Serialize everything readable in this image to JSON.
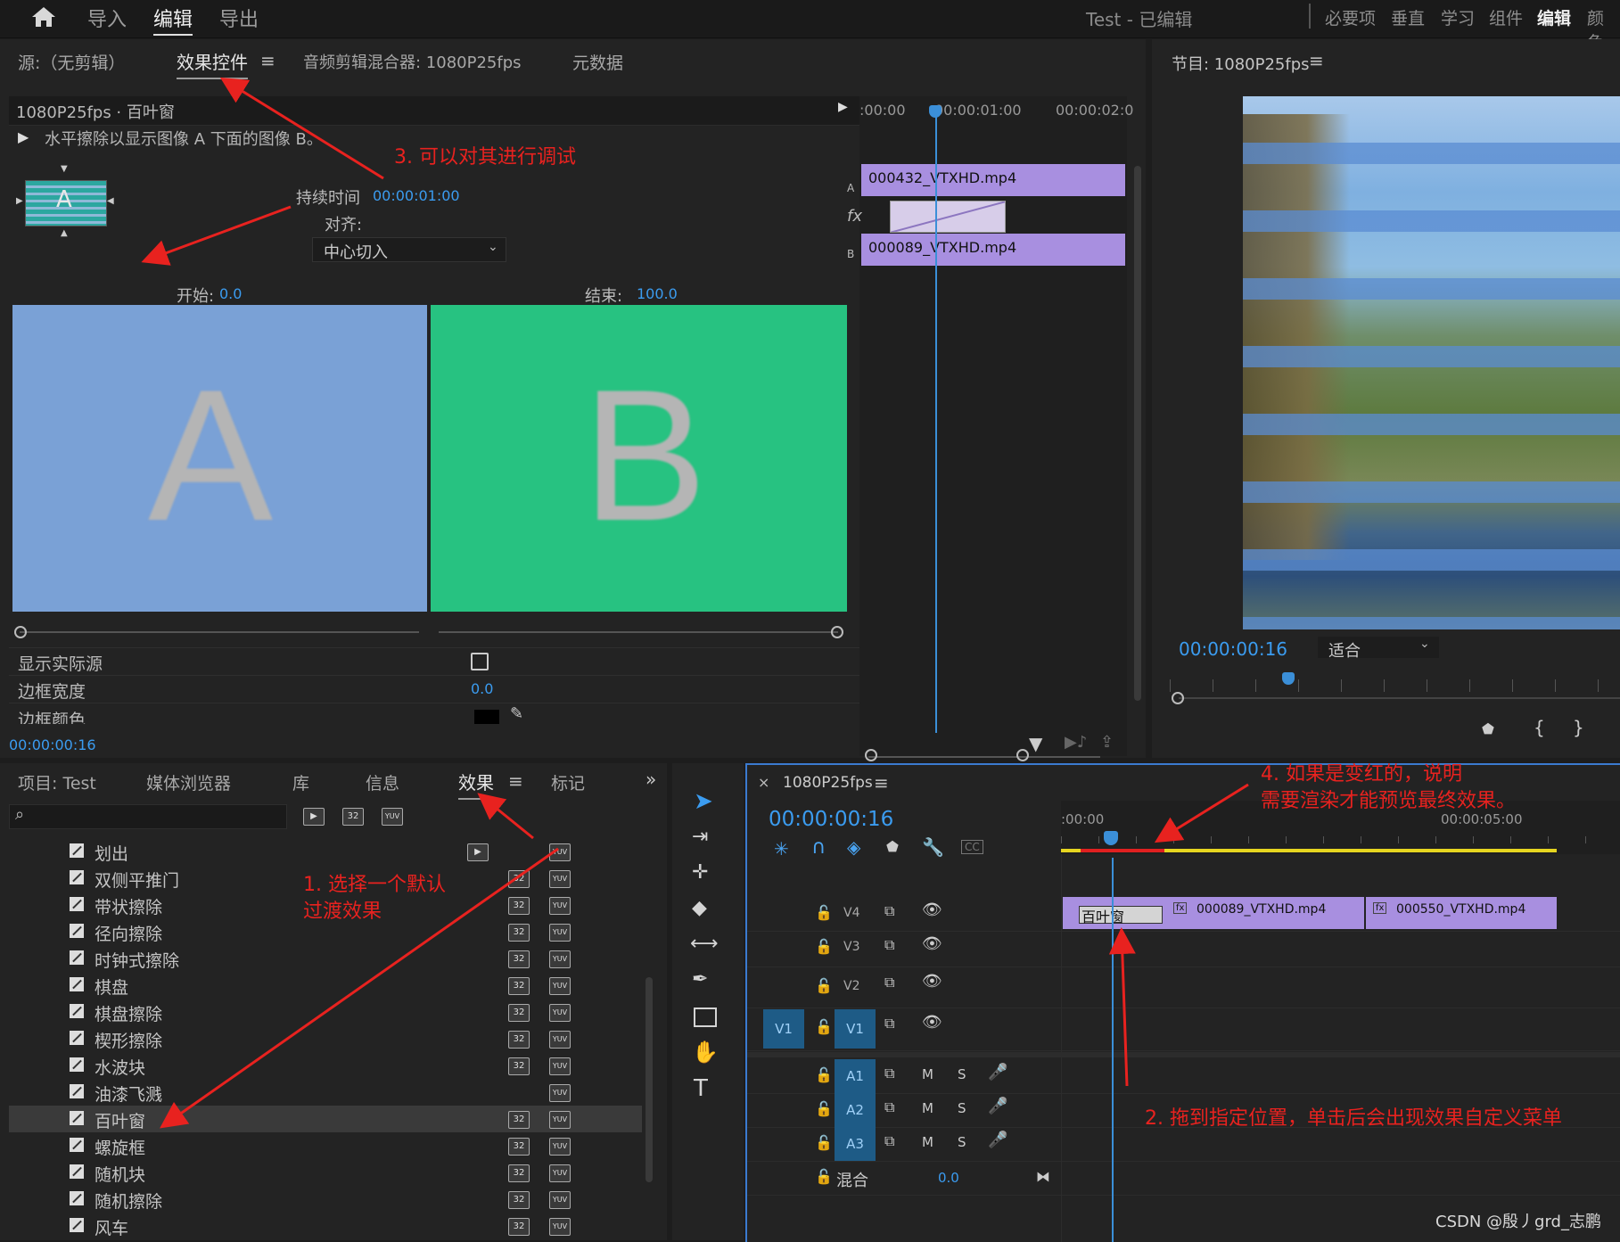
{
  "topbar": {
    "nav": [
      "导入",
      "编辑",
      "导出"
    ],
    "active": "编辑",
    "project_title": "Test - 已编辑",
    "workspaces": [
      "必要项",
      "垂直",
      "学习",
      "组件",
      "编辑",
      "颜色"
    ],
    "active_workspace": "编辑"
  },
  "source_panel": {
    "tabs": [
      "源:（无剪辑）",
      "效果控件",
      "音频剪辑混合器: 1080P25fps",
      "元数据"
    ],
    "active_tab": "效果控件",
    "clip_path": "1080P25fps · 百叶窗",
    "description": "水平擦除以显示图像 A 下面的图像 B。",
    "duration_label": "持续时间",
    "duration_value": "00:00:01:00",
    "align_label": "对齐:",
    "align_value": "中心切入",
    "start_label": "开始:",
    "start_value": "0.0",
    "end_label": "结束:",
    "end_value": "100.0",
    "preview_a": "A",
    "preview_b": "B",
    "show_actual_sources": "显示实际源",
    "border_width_label": "边框宽度",
    "border_width_value": "0.0",
    "border_color_label": "边框颜色",
    "timecode": "00:00:00:16",
    "mini_timeline": {
      "ruler": [
        ":00:00",
        "00:00:01:00",
        "00:00:02:0"
      ],
      "track_a_label": "A",
      "track_b_label": "B",
      "fx_label": "fx",
      "clip_a": "000432_VTXHD.mp4",
      "clip_b": "000089_VTXHD.mp4"
    }
  },
  "program_panel": {
    "title": "节目: 1080P25fps",
    "timecode": "00:00:00:16",
    "fit": "适合"
  },
  "project_panel": {
    "tabs": [
      "项目: Test",
      "媒体浏览器",
      "库",
      "信息",
      "效果",
      "标记"
    ],
    "active_tab": "效果",
    "search_placeholder": "",
    "effects": [
      {
        "name": "划出",
        "b32": false,
        "yuv": true,
        "acc": true
      },
      {
        "name": "双侧平推门",
        "b32": true,
        "yuv": true
      },
      {
        "name": "带状擦除",
        "b32": true,
        "yuv": true
      },
      {
        "name": "径向擦除",
        "b32": true,
        "yuv": true
      },
      {
        "name": "时钟式擦除",
        "b32": true,
        "yuv": true
      },
      {
        "name": "棋盘",
        "b32": true,
        "yuv": true
      },
      {
        "name": "棋盘擦除",
        "b32": true,
        "yuv": true
      },
      {
        "name": "楔形擦除",
        "b32": true,
        "yuv": true
      },
      {
        "name": "水波块",
        "b32": true,
        "yuv": true
      },
      {
        "name": "油漆飞溅",
        "b32": false,
        "yuv": true
      },
      {
        "name": "百叶窗",
        "b32": true,
        "yuv": true,
        "selected": true
      },
      {
        "name": "螺旋框",
        "b32": true,
        "yuv": true
      },
      {
        "name": "随机块",
        "b32": true,
        "yuv": true
      },
      {
        "name": "随机擦除",
        "b32": true,
        "yuv": true
      },
      {
        "name": "风车",
        "b32": true,
        "yuv": true
      }
    ],
    "badge_32": "32",
    "badge_yuv": "YUV"
  },
  "timeline": {
    "title": "1080P25fps",
    "timecode": "00:00:00:16",
    "ruler": [
      ":00:00",
      "00:00:05:00"
    ],
    "video_tracks": [
      "V4",
      "V3",
      "V2",
      "V1"
    ],
    "audio_tracks": [
      "A1",
      "A2",
      "A3"
    ],
    "source_patch": "V1",
    "mix_label": "混合",
    "mix_value": "0.0",
    "m_label": "M",
    "s_label": "S",
    "transition_clip": "百叶窗",
    "clip1": "000089_VTXHD.mp4",
    "clip2": "000550_VTXHD.mp4",
    "fx_badge": "fx"
  },
  "annotations": {
    "a1": "1. 选择一个默认\n过渡效果",
    "a2": "2. 拖到指定位置，单击后会出现效果自定义菜单",
    "a3": "3. 可以对其进行调试",
    "a4": "4. 如果是变红的，说明\n需要渲染才能预览最终效果。"
  },
  "watermark": "CSDN @殷丿grd_志鹏",
  "colors": {
    "accent_blue": "#3b9cf0",
    "clip_purple": "#a88fe0",
    "preview_a_bg": "#7aa1d6",
    "preview_b_bg": "#27c281",
    "annotation_red": "#e8221f",
    "render_bar_yellow": "#e6d520",
    "render_bar_red": "#e02020",
    "track_patch_blue": "#1e5b86"
  }
}
